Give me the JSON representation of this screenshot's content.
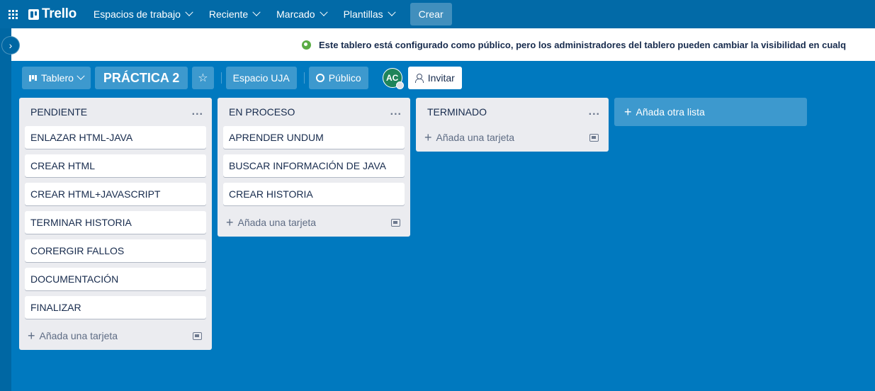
{
  "topnav": {
    "logo": "Trello",
    "menus": [
      {
        "label": "Espacios de trabajo"
      },
      {
        "label": "Reciente"
      },
      {
        "label": "Marcado"
      },
      {
        "label": "Plantillas"
      }
    ],
    "create_label": "Crear"
  },
  "banner": {
    "text": "Este tablero está configurado como público, pero los administradores del tablero pueden cambiar la visibilidad en cualq"
  },
  "board": {
    "view_label": "Tablero",
    "title": "PRÁCTICA 2",
    "star_icon": "☆",
    "workspace_label": "Espacio UJA",
    "visibility_label": "Público",
    "avatar_initials": "AC",
    "invite_label": "Invitar"
  },
  "lists": [
    {
      "title": "PENDIENTE",
      "cards": [
        "ENLAZAR HTML-JAVA",
        "CREAR HTML",
        "CREAR HTML+JAVASCRIPT",
        "TERMINAR HISTORIA",
        "CORERGIR FALLOS",
        "DOCUMENTACIÓN",
        "FINALIZAR"
      ],
      "add_label": "Añada una tarjeta"
    },
    {
      "title": "EN PROCESO",
      "cards": [
        "APRENDER UNDUM",
        "BUSCAR INFORMACIÓN DE JAVA",
        "CREAR HISTORIA"
      ],
      "add_label": "Añada una tarjeta"
    },
    {
      "title": "TERMINADO",
      "cards": [],
      "add_label": "Añada una tarjeta"
    }
  ],
  "add_list_label": "Añada otra lista",
  "menu_glyph": "...",
  "plus_glyph": "+",
  "colors": {
    "board_bg": "#0079bf",
    "nav_bg": "#026aa7",
    "list_bg": "#ebecf0"
  }
}
